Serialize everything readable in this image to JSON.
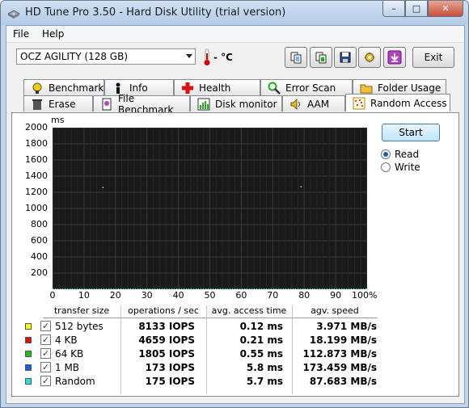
{
  "window": {
    "title": "HD Tune Pro 3.50 - Hard Disk Utility (trial version)",
    "minimize_glyph": "–",
    "maximize_glyph": "□",
    "close_glyph": "✕"
  },
  "menu": {
    "file": "File",
    "help": "Help"
  },
  "toolbar": {
    "drive": "OCZ AGILITY (128 GB)",
    "temperature": "- °C",
    "exit_label": "Exit",
    "icons": [
      "copy-icon",
      "copy-screenshot-icon",
      "save-icon",
      "options-icon",
      "download-icon"
    ]
  },
  "tabs_row1": [
    {
      "label": "Benchmark",
      "icon": "benchmark-icon"
    },
    {
      "label": "Info",
      "icon": "info-icon"
    },
    {
      "label": "Health",
      "icon": "health-icon"
    },
    {
      "label": "Error Scan",
      "icon": "error-scan-icon"
    },
    {
      "label": "Folder Usage",
      "icon": "folder-icon"
    }
  ],
  "tabs_row2": [
    {
      "label": "Erase",
      "icon": "erase-icon"
    },
    {
      "label": "File Benchmark",
      "icon": "file-benchmark-icon"
    },
    {
      "label": "Disk monitor",
      "icon": "disk-monitor-icon"
    },
    {
      "label": "AAM",
      "icon": "speaker-icon"
    },
    {
      "label": "Random Access",
      "icon": "random-access-icon",
      "active": true
    }
  ],
  "controls": {
    "start_label": "Start",
    "read_label": "Read",
    "write_label": "Write",
    "selected_mode": "Read"
  },
  "chart_data": {
    "type": "scatter",
    "ylabel": "ms",
    "ylim": [
      0,
      2000
    ],
    "yticks": [
      "2000",
      "1800",
      "1600",
      "1400",
      "1200",
      "1000",
      "800",
      "600",
      "400",
      "200"
    ],
    "xlim": [
      0,
      100
    ],
    "xticks": [
      "0",
      "10",
      "20",
      "30",
      "40",
      "50",
      "60",
      "70",
      "80",
      "90",
      "100%"
    ],
    "grid": true,
    "series": [
      {
        "name": "512 bytes",
        "color": "#ffff00",
        "values": [
          [
            16,
            1260
          ],
          [
            79,
            1270
          ]
        ]
      },
      {
        "name": "Random",
        "color": "#00ffff",
        "values": [
          [
            0,
            6
          ],
          [
            100,
            6
          ]
        ]
      }
    ]
  },
  "results": {
    "headers": [
      "transfer size",
      "operations / sec",
      "avg. access time",
      "agv. speed"
    ],
    "rows": [
      {
        "size": "512 bytes",
        "ops": "8133 IOPS",
        "access": "0.12 ms",
        "speed": "3.971 MB/s",
        "color": "#ffff00",
        "checked": "✓"
      },
      {
        "size": "4 KB",
        "ops": "4659 IOPS",
        "access": "0.21 ms",
        "speed": "18.199 MB/s",
        "color": "#e01010",
        "checked": "✓"
      },
      {
        "size": "64 KB",
        "ops": "1805 IOPS",
        "access": "0.55 ms",
        "speed": "112.873 MB/s",
        "color": "#20c020",
        "checked": "✓"
      },
      {
        "size": "1 MB",
        "ops": "173 IOPS",
        "access": "5.8 ms",
        "speed": "173.459 MB/s",
        "color": "#1060e0",
        "checked": "✓"
      },
      {
        "size": "Random",
        "ops": "175 IOPS",
        "access": "5.7 ms",
        "speed": "87.683 MB/s",
        "color": "#20e0e0",
        "checked": "✓"
      }
    ]
  }
}
